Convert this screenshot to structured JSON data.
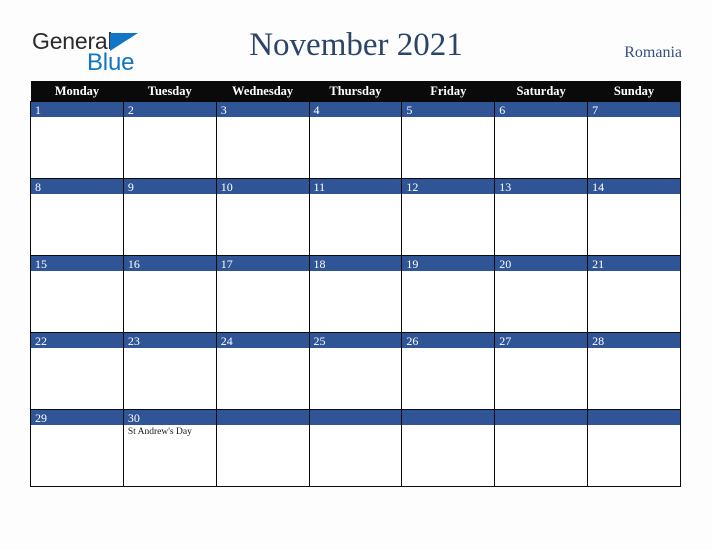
{
  "brand": {
    "name_part1": "General",
    "name_part2": "Blue",
    "triangle_icon": "triangle-icon",
    "color_dark": "#2b2b2b",
    "color_blue": "#1176c4"
  },
  "header": {
    "title": "November 2021",
    "country": "Romania",
    "title_color": "#2b4468"
  },
  "calendar": {
    "weekday_headers": [
      "Monday",
      "Tuesday",
      "Wednesday",
      "Thursday",
      "Friday",
      "Saturday",
      "Sunday"
    ],
    "header_bg": "#0a0a0a",
    "date_band_color": "#2f5597",
    "weeks": [
      [
        {
          "date": "1",
          "events": []
        },
        {
          "date": "2",
          "events": []
        },
        {
          "date": "3",
          "events": []
        },
        {
          "date": "4",
          "events": []
        },
        {
          "date": "5",
          "events": []
        },
        {
          "date": "6",
          "events": []
        },
        {
          "date": "7",
          "events": []
        }
      ],
      [
        {
          "date": "8",
          "events": []
        },
        {
          "date": "9",
          "events": []
        },
        {
          "date": "10",
          "events": []
        },
        {
          "date": "11",
          "events": []
        },
        {
          "date": "12",
          "events": []
        },
        {
          "date": "13",
          "events": []
        },
        {
          "date": "14",
          "events": []
        }
      ],
      [
        {
          "date": "15",
          "events": []
        },
        {
          "date": "16",
          "events": []
        },
        {
          "date": "17",
          "events": []
        },
        {
          "date": "18",
          "events": []
        },
        {
          "date": "19",
          "events": []
        },
        {
          "date": "20",
          "events": []
        },
        {
          "date": "21",
          "events": []
        }
      ],
      [
        {
          "date": "22",
          "events": []
        },
        {
          "date": "23",
          "events": []
        },
        {
          "date": "24",
          "events": []
        },
        {
          "date": "25",
          "events": []
        },
        {
          "date": "26",
          "events": []
        },
        {
          "date": "27",
          "events": []
        },
        {
          "date": "28",
          "events": []
        }
      ],
      [
        {
          "date": "29",
          "events": []
        },
        {
          "date": "30",
          "events": [
            "St Andrew's Day"
          ]
        },
        {
          "date": "",
          "events": []
        },
        {
          "date": "",
          "events": []
        },
        {
          "date": "",
          "events": []
        },
        {
          "date": "",
          "events": []
        },
        {
          "date": "",
          "events": []
        }
      ]
    ]
  }
}
